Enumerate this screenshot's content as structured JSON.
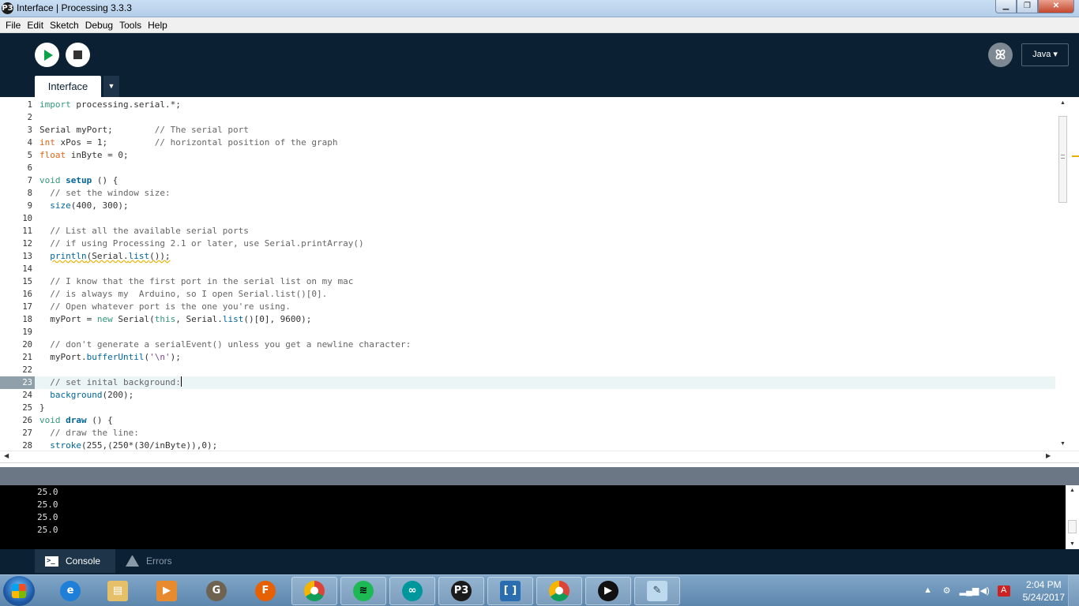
{
  "window": {
    "title": "Interface | Processing 3.3.3",
    "icon_glyph": "P3"
  },
  "menu": [
    "File",
    "Edit",
    "Sketch",
    "Debug",
    "Tools",
    "Help"
  ],
  "toolbar": {
    "mode_label": "Java ▾"
  },
  "tab": {
    "name": "Interface",
    "menu_glyph": "▼"
  },
  "editor": {
    "current_line": 23,
    "lines": [
      "import processing.serial.*;",
      "",
      "Serial myPort;        // The serial port",
      "int xPos = 1;         // horizontal position of the graph",
      "float inByte = 0;",
      "",
      "void setup () {",
      "  // set the window size:",
      "  size(400, 300);",
      "",
      "  // List all the available serial ports",
      "  // if using Processing 2.1 or later, use Serial.printArray()",
      "  println(Serial.list());",
      "",
      "  // I know that the first port in the serial list on my mac",
      "  // is always my  Arduino, so I open Serial.list()[0].",
      "  // Open whatever port is the one you're using.",
      "  myPort = new Serial(this, Serial.list()[0], 9600);",
      "",
      "  // don't generate a serialEvent() unless you get a newline character:",
      "  myPort.bufferUntil('\\n');",
      "",
      "  // set inital background:",
      "  background(200);",
      "}",
      "void draw () {",
      "  // draw the line:",
      "  stroke(255,(250*(30/inByte)),0);"
    ]
  },
  "console": {
    "lines": [
      "25.0",
      "25.0",
      "25.0",
      "25.0"
    ]
  },
  "footer_tabs": {
    "console": "Console",
    "errors": "Errors"
  },
  "taskbar": {
    "time": "2:04 PM",
    "date": "5/24/2017"
  }
}
